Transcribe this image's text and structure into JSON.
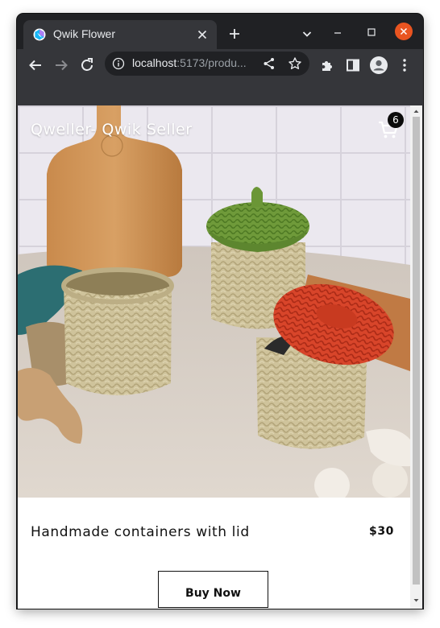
{
  "browser": {
    "tab": {
      "title": "Qwik Flower",
      "favicon": "qwik-logo-icon"
    },
    "address_bar": {
      "host": "localhost",
      "rest": ":5173/produ..."
    },
    "colors": {
      "frame": "#202124",
      "toolbar": "#35363a",
      "close_button": "#e95420"
    }
  },
  "page": {
    "brand": "Qweller- Qwik Seller",
    "cart": {
      "count": "6",
      "icon": "cart-icon"
    },
    "product": {
      "name": "Handmade containers with lid",
      "price": "$30",
      "image": "seagrass baskets with lids photo"
    },
    "buy_button": "Buy Now"
  }
}
